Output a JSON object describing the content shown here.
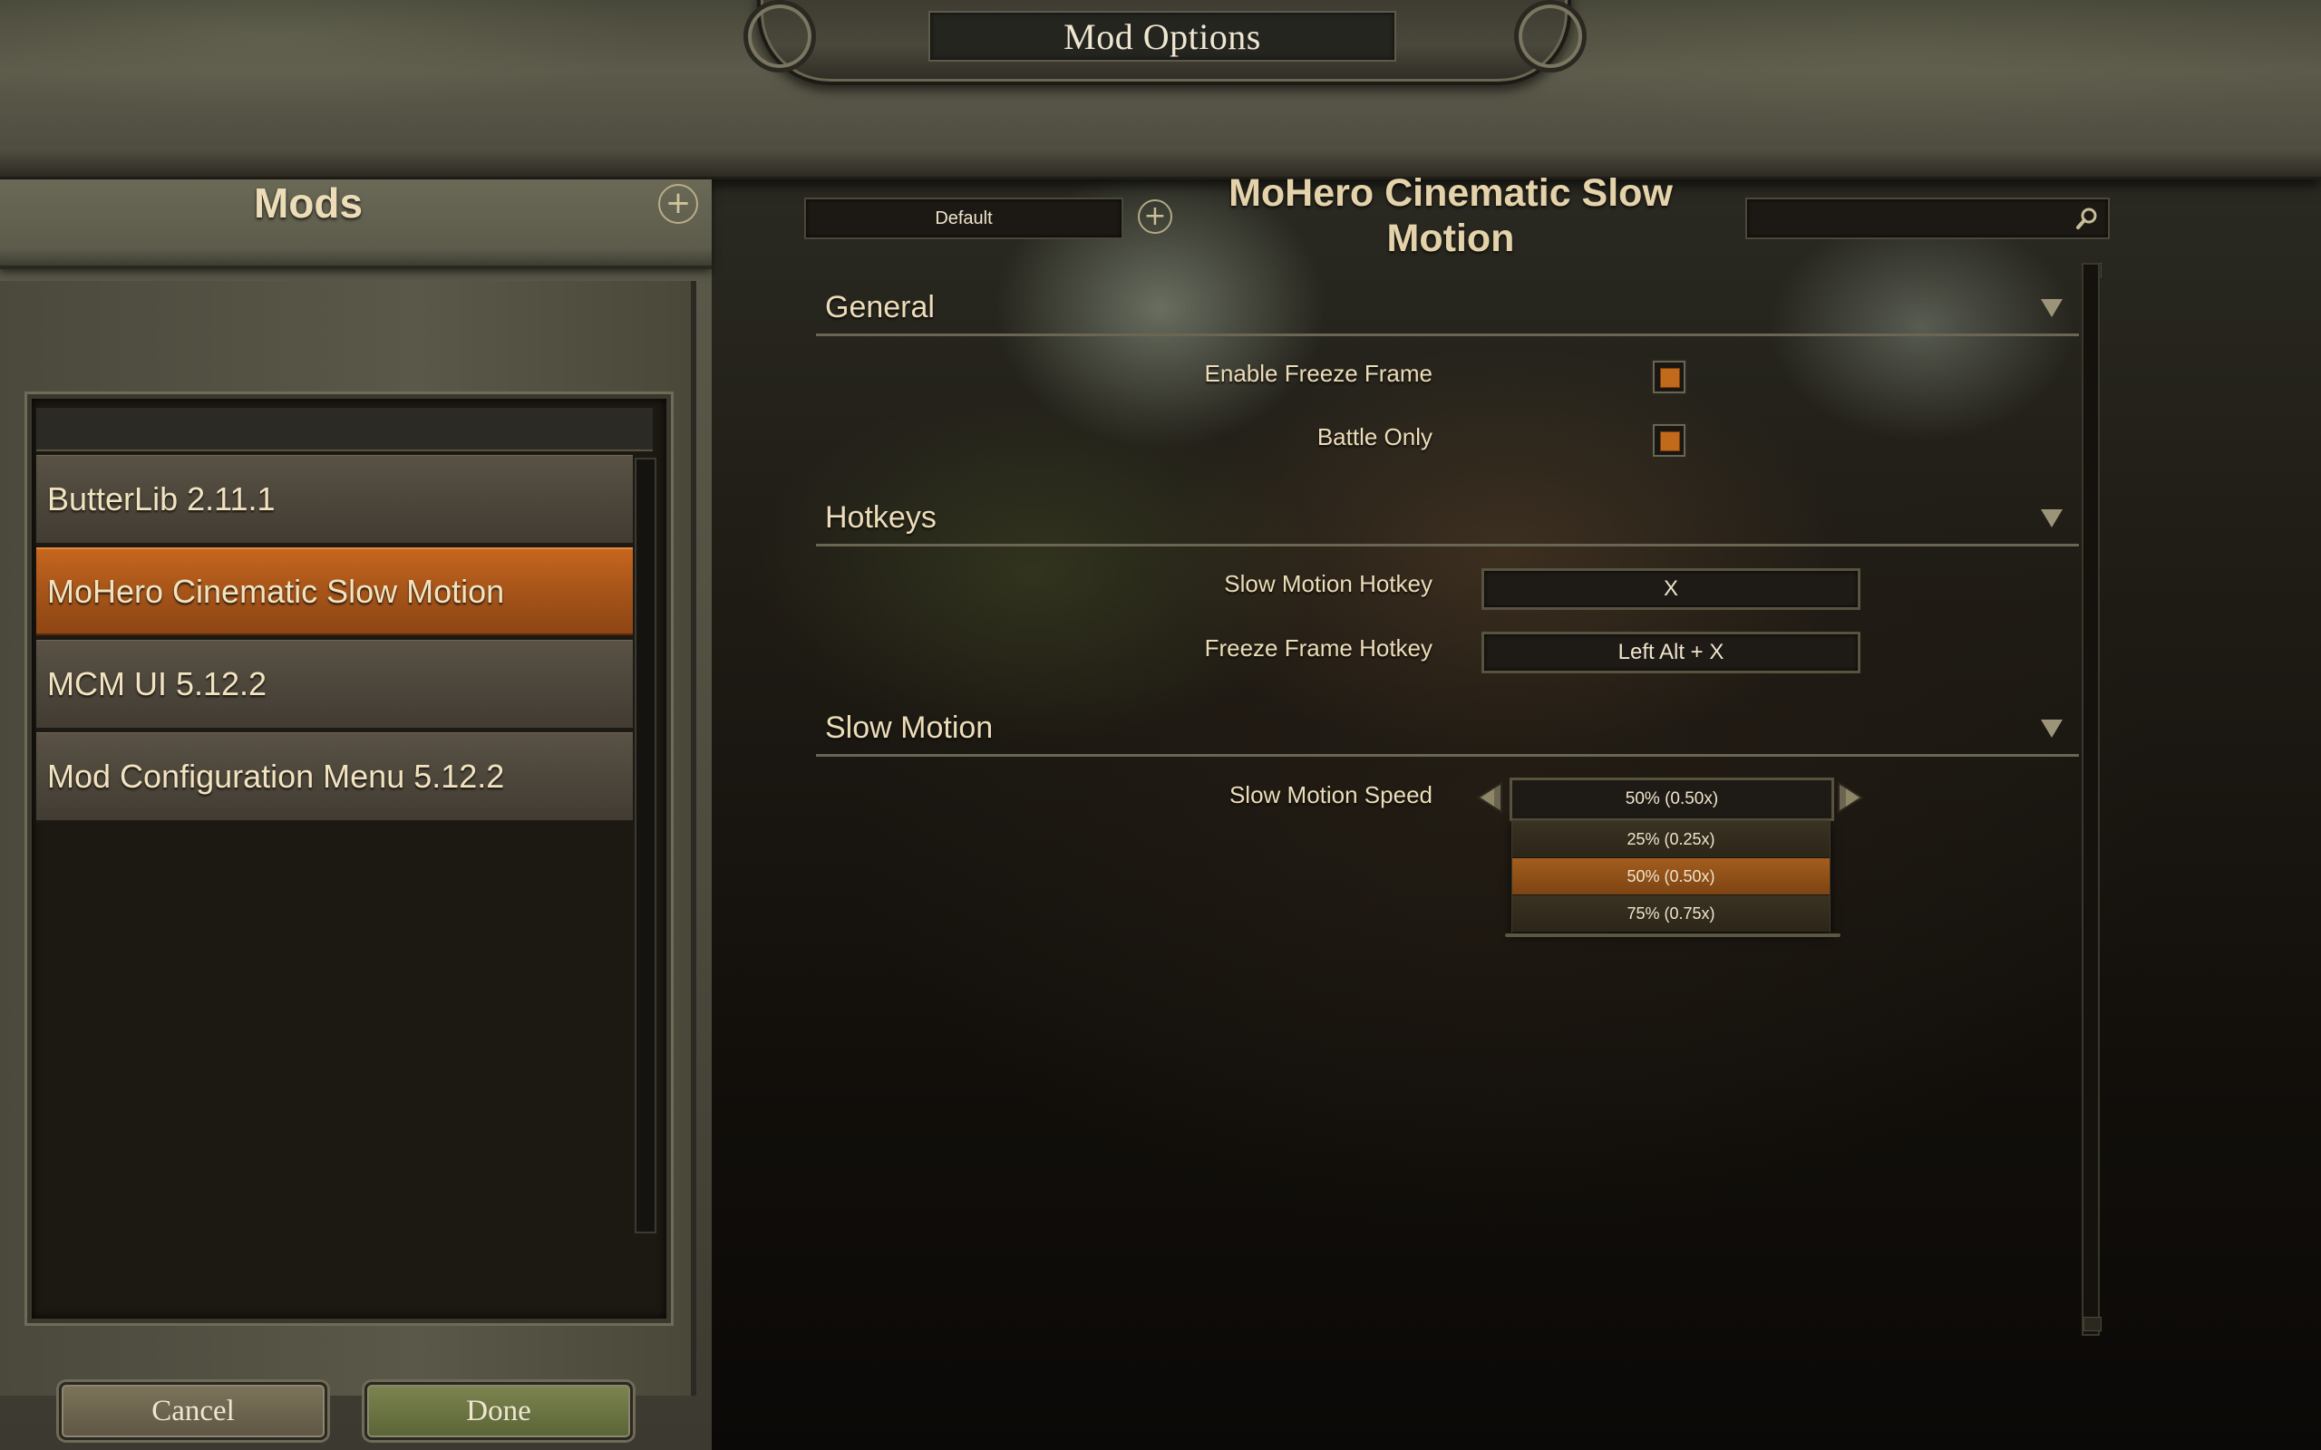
{
  "window": {
    "title": "Mod Options"
  },
  "sidebar": {
    "title": "Mods",
    "items": [
      {
        "label": "ButterLib 2.11.1",
        "selected": false
      },
      {
        "label": "MoHero Cinematic Slow Motion",
        "selected": true
      },
      {
        "label": "MCM UI 5.12.2",
        "selected": false
      },
      {
        "label": "Mod Configuration Menu 5.12.2",
        "selected": false
      }
    ]
  },
  "footer": {
    "cancel_label": "Cancel",
    "done_label": "Done"
  },
  "main": {
    "preset": "Default",
    "mod_title": "MoHero Cinematic Slow Motion",
    "search": {
      "value": "",
      "placeholder": ""
    },
    "sections": {
      "general": {
        "title": "General",
        "enable_freeze_frame": {
          "label": "Enable Freeze Frame",
          "checked": true
        },
        "battle_only": {
          "label": "Battle Only",
          "checked": true
        }
      },
      "hotkeys": {
        "title": "Hotkeys",
        "slow_motion_hotkey": {
          "label": "Slow Motion Hotkey",
          "value": "X"
        },
        "freeze_frame_hotkey": {
          "label": "Freeze Frame Hotkey",
          "value": "Left Alt + X"
        }
      },
      "slow_motion": {
        "title": "Slow Motion",
        "speed": {
          "label": "Slow Motion Speed",
          "selected": "50% (0.50x)",
          "options": [
            "25% (0.25x)",
            "50% (0.50x)",
            "75% (0.75x)"
          ]
        }
      }
    }
  },
  "colors": {
    "accent": "#c26a1c",
    "selected_item": "#a9561a",
    "text": "#ecdcb8",
    "done_button": "#6a7443"
  },
  "icons": {
    "add": "plus-circle-icon",
    "search": "magnifier-icon",
    "collapse": "triangle-down-icon",
    "prev": "arrow-left-icon",
    "next": "arrow-right-icon"
  }
}
